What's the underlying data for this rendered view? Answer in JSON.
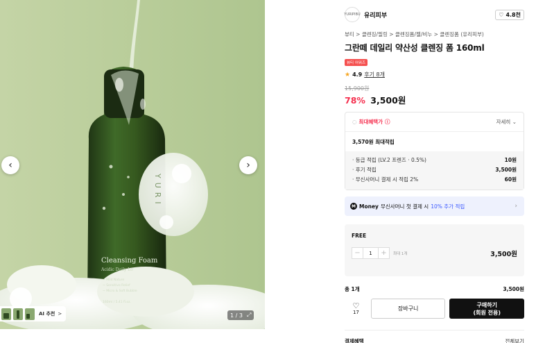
{
  "gallery": {
    "bottle_text_brand": "YURI",
    "bottle_text_product": "Cleansing Foam",
    "bottle_text_sub": "Acidic Daily Lo",
    "bottle_text_lines": [
      "~ Mild Nature",
      "~ Sensitive Relief",
      "~ Micro & Soft Bubble",
      "160ml / 5.41 fl.oz."
    ],
    "prev_icon": "chevron-left-icon",
    "next_icon": "chevron-right-icon",
    "ai_badge": "AI 추천",
    "ai_arrow": ">",
    "counter": "1 / 3",
    "expand_icon": "expand-icon",
    "bg_color": "#b9cd9d"
  },
  "brand": {
    "logo_text": "YURIPIBU",
    "name": "유리피부",
    "like_count": "4.8천"
  },
  "breadcrumb": "뷰티 > 클렌징/필링 > 클렌징폼/젤/비누 > 클렌징폼 (유리피부)",
  "product": {
    "title": "그란떼 데일리 약산성 클렌징 폼 160ml",
    "tag": "뷰티 어워즈",
    "rating": "4.9",
    "review_link": "후기 8개",
    "original_price": "15,900원",
    "discount": "78%",
    "sale_price": "3,500원"
  },
  "benefits": {
    "title": "최대혜택가",
    "detail": "자세히",
    "total": "3,570원 최대적립",
    "lines": [
      {
        "label": "· 등급 적립 (LV.2 프렌즈 · 0.5%)",
        "amount": "10원"
      },
      {
        "label": "· 후기 적립",
        "amount": "3,500원"
      },
      {
        "label": "· 무신사머니 결제 시 적립 2%",
        "amount": "60원"
      }
    ]
  },
  "money_banner": {
    "brand": "Money",
    "text": "무신사머니 첫 결제 시",
    "accent": "10% 추가 적립",
    "accent_color": "#3d5afe"
  },
  "option": {
    "name": "FREE",
    "quantity": "1",
    "max_note": "최대 1개",
    "price": "3,500원"
  },
  "summary": {
    "total_label": "총 1개",
    "total_price": "3,500원"
  },
  "actions": {
    "wish_count": "17",
    "cart_label": "장바구니",
    "buy_label": "구매하기\n(회원 전용)"
  },
  "payment": {
    "title": "결제혜택",
    "link": "전체보기"
  },
  "colors": {
    "accent_red": "#f5304f",
    "buy_button": "#111111"
  }
}
